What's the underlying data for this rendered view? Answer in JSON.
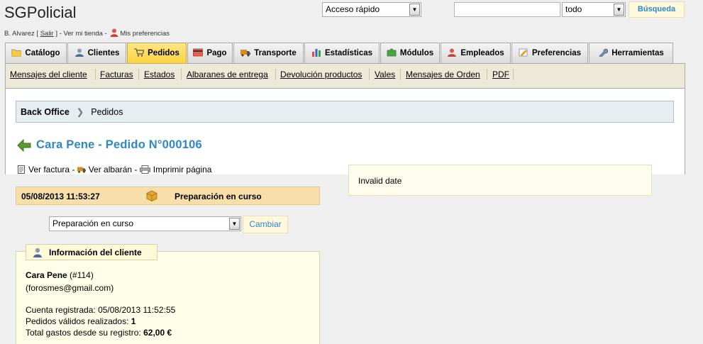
{
  "header": {
    "logo": "SGPolicial",
    "quick_access": "Acceso rápido",
    "search_value": "",
    "search_scope": "todo",
    "search_button": "Búsqueda"
  },
  "user": {
    "name": "B. Alvarez",
    "logout": "Salir",
    "view_store": "Ver mi tienda",
    "preferences": "Mis preferencias"
  },
  "tabs": [
    {
      "label": "Catálogo",
      "icon": "folder-icon"
    },
    {
      "label": "Clientes",
      "icon": "customers-icon"
    },
    {
      "label": "Pedidos",
      "icon": "orders-icon",
      "active": true
    },
    {
      "label": "Pago",
      "icon": "payment-icon"
    },
    {
      "label": "Transporte",
      "icon": "truck-icon"
    },
    {
      "label": "Estadísticas",
      "icon": "stats-icon"
    },
    {
      "label": "Módulos",
      "icon": "puzzle-icon"
    },
    {
      "label": "Empleados",
      "icon": "employee-icon"
    },
    {
      "label": "Preferencias",
      "icon": "preferences-icon"
    },
    {
      "label": "Herramientas",
      "icon": "wrench-icon"
    }
  ],
  "subnav": [
    "Mensajes del cliente",
    "Facturas",
    "Estados",
    "Albaranes de entrega",
    "Devolución productos",
    "Vales",
    "Mensajes de Orden",
    "PDF"
  ],
  "breadcrumb": {
    "root": "Back Office",
    "current": "Pedidos"
  },
  "page": {
    "title": "Cara Pene - Pedido N°000106"
  },
  "actions": {
    "invoice": "Ver factura",
    "sep1": " - ",
    "delivery": "Ver albarán",
    "sep2": " - ",
    "print": "Imprimir página"
  },
  "status": {
    "date": "05/08/2013 11:53:27",
    "label": "Preparación en curso",
    "select_value": "Preparación en curso",
    "change_button": "Cambiar"
  },
  "customer": {
    "legend": "Información del cliente",
    "name": "Cara Pene",
    "id": "(#114)",
    "email": "(forosmes@gmail.com)",
    "registered_label": "Cuenta registrada:",
    "registered_value": "05/08/2013 11:52:55",
    "valid_orders_label": "Pedidos válidos realizados:",
    "valid_orders_value": "1",
    "total_spent_label": "Total gastos desde su registro:",
    "total_spent_value": "62,00 €"
  },
  "date_box": {
    "text": "Invalid date"
  },
  "colors": {
    "accent_blue": "#2e87c6",
    "tab_active": "#fdd23b",
    "status_bg": "#f8dfaa",
    "customer_bg": "#fffee8"
  }
}
